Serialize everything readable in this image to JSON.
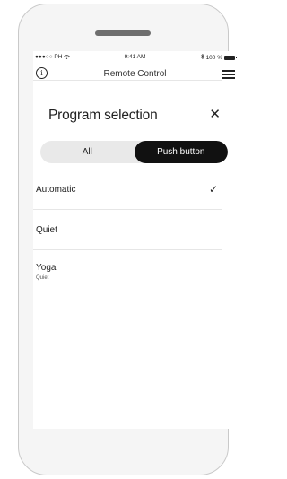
{
  "status_bar": {
    "carrier": "●●●○○ PH",
    "time": "9:41 AM",
    "battery": "100 %"
  },
  "app_bar": {
    "title": "Remote Control",
    "info_icon": "i"
  },
  "panel": {
    "title": "Program selection",
    "close_glyph": "✕"
  },
  "tabs": [
    {
      "label": "All",
      "selected": false
    },
    {
      "label": "Push button",
      "selected": true
    }
  ],
  "programs": [
    {
      "name": "Automatic",
      "subtitle": "",
      "checked": true
    },
    {
      "name": "Quiet",
      "subtitle": "",
      "checked": false
    },
    {
      "name": "Yoga",
      "subtitle": "Quiet",
      "checked": false
    }
  ],
  "icons": {
    "check": "✓",
    "wifi": "wifi-icon",
    "bluetooth": "bluetooth-icon",
    "menu": "hamburger-menu-icon"
  },
  "colors": {
    "accent": "#111111",
    "divider": "#e6e6e6",
    "segment_bg": "#e9e9e9"
  }
}
